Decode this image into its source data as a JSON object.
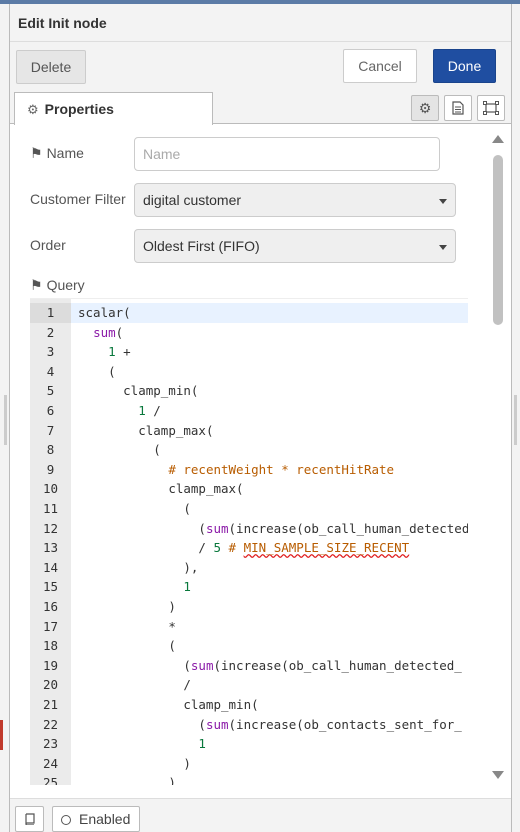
{
  "header": {
    "title": "Edit Init node"
  },
  "toolbar": {
    "delete_label": "Delete",
    "cancel_label": "Cancel",
    "done_label": "Done"
  },
  "tabs": {
    "properties_label": "Properties",
    "icons": [
      "gear-icon",
      "description-icon",
      "appearance-icon"
    ]
  },
  "form": {
    "name_label": "Name",
    "name_placeholder": "Name",
    "customer_filter_label": "Customer Filter",
    "customer_filter_value": "digital customer",
    "order_label": "Order",
    "order_value": "Oldest First (FIFO)",
    "query_label": "Query"
  },
  "editor": {
    "active_line": 1,
    "lines": [
      {
        "n": "1",
        "indent": "",
        "tokens": [
          [
            "scalar(",
            "fn"
          ]
        ]
      },
      {
        "n": "2",
        "indent": "  ",
        "tokens": [
          [
            "sum",
            "call"
          ],
          [
            "(",
            "fn"
          ]
        ]
      },
      {
        "n": "3",
        "indent": "    ",
        "tokens": [
          [
            "1",
            "num"
          ],
          [
            " +",
            "fn"
          ]
        ]
      },
      {
        "n": "4",
        "indent": "    ",
        "tokens": [
          [
            "(",
            "fn"
          ]
        ]
      },
      {
        "n": "5",
        "indent": "      ",
        "tokens": [
          [
            "clamp_min(",
            "fn"
          ]
        ]
      },
      {
        "n": "6",
        "indent": "        ",
        "tokens": [
          [
            "1",
            "num"
          ],
          [
            " /",
            "fn"
          ]
        ]
      },
      {
        "n": "7",
        "indent": "        ",
        "tokens": [
          [
            "clamp_max(",
            "fn"
          ]
        ]
      },
      {
        "n": "8",
        "indent": "          ",
        "tokens": [
          [
            "(",
            "fn"
          ]
        ]
      },
      {
        "n": "9",
        "indent": "            ",
        "tokens": [
          [
            "# recentWeight * recentHitRate",
            "com"
          ]
        ]
      },
      {
        "n": "10",
        "indent": "            ",
        "tokens": [
          [
            "clamp_max(",
            "fn"
          ]
        ]
      },
      {
        "n": "11",
        "indent": "              ",
        "tokens": [
          [
            "(",
            "fn"
          ]
        ]
      },
      {
        "n": "12",
        "indent": "                ",
        "tokens": [
          [
            "(",
            "fn"
          ],
          [
            "sum",
            "call"
          ],
          [
            "(increase(ob_call_human_detected_",
            "fn"
          ]
        ]
      },
      {
        "n": "13",
        "indent": "                ",
        "tokens": [
          [
            "/ ",
            "fn"
          ],
          [
            "5",
            "num"
          ],
          [
            " ",
            "fn"
          ],
          [
            "# MIN_SAMPLE_SIZE_RECENT",
            "comsq"
          ]
        ]
      },
      {
        "n": "14",
        "indent": "              ",
        "tokens": [
          [
            "),",
            "fn"
          ]
        ]
      },
      {
        "n": "15",
        "indent": "              ",
        "tokens": [
          [
            "1",
            "num"
          ]
        ]
      },
      {
        "n": "16",
        "indent": "            ",
        "tokens": [
          [
            ")",
            "fn"
          ]
        ]
      },
      {
        "n": "17",
        "indent": "            ",
        "tokens": [
          [
            "*",
            "fn"
          ]
        ]
      },
      {
        "n": "18",
        "indent": "            ",
        "tokens": [
          [
            "(",
            "fn"
          ]
        ]
      },
      {
        "n": "19",
        "indent": "              ",
        "tokens": [
          [
            "(",
            "fn"
          ],
          [
            "sum",
            "call"
          ],
          [
            "(increase(ob_call_human_detected_",
            "fn"
          ]
        ]
      },
      {
        "n": "20",
        "indent": "              ",
        "tokens": [
          [
            "/",
            "fn"
          ]
        ]
      },
      {
        "n": "21",
        "indent": "              ",
        "tokens": [
          [
            "clamp_min(",
            "fn"
          ]
        ]
      },
      {
        "n": "22",
        "indent": "                ",
        "tokens": [
          [
            "(",
            "fn"
          ],
          [
            "sum",
            "call"
          ],
          [
            "(increase(ob_contacts_sent_for_",
            "fn"
          ]
        ]
      },
      {
        "n": "23",
        "indent": "                ",
        "tokens": [
          [
            "1",
            "num"
          ]
        ]
      },
      {
        "n": "24",
        "indent": "              ",
        "tokens": [
          [
            ")",
            "fn"
          ]
        ]
      },
      {
        "n": "25",
        "indent": "            ",
        "tokens": [
          [
            ")",
            "fn"
          ]
        ]
      }
    ]
  },
  "footer": {
    "enabled_label": "Enabled"
  }
}
